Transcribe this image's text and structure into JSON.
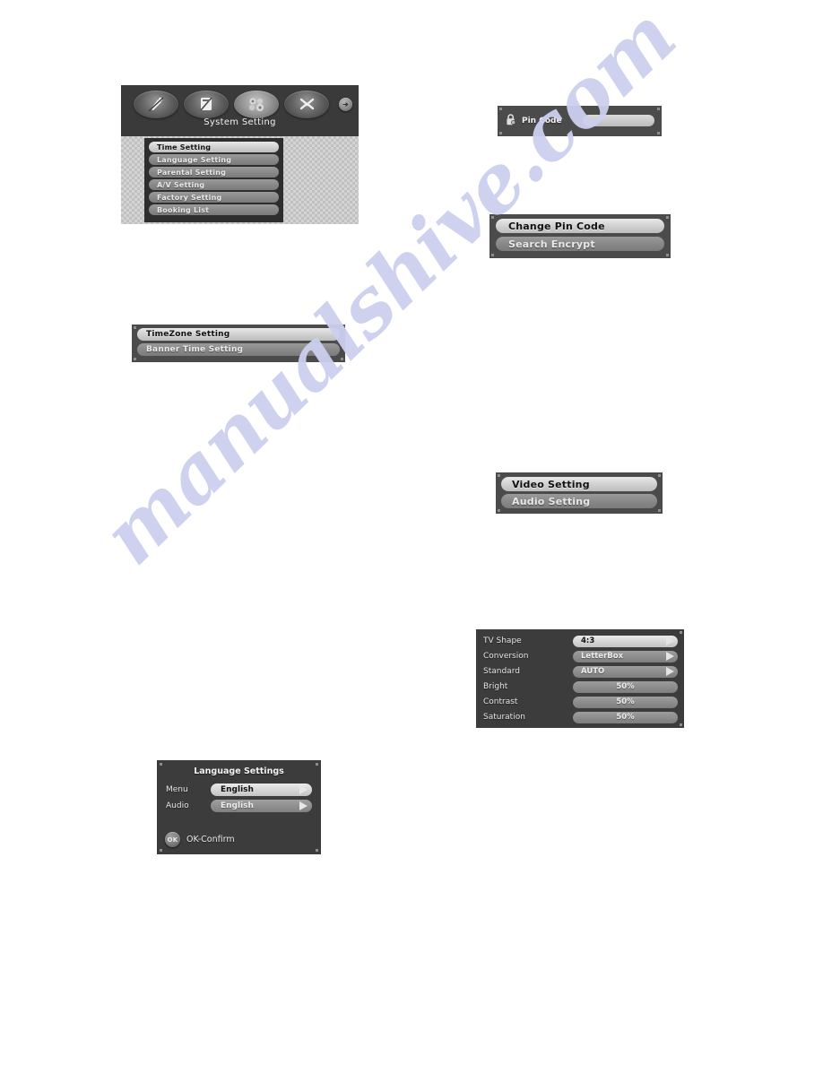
{
  "watermark": {
    "text": "manualshive.com"
  },
  "system_menu": {
    "title": "System Setting",
    "toolbar_icons": [
      {
        "name": "satellite-dish-icon",
        "active": false
      },
      {
        "name": "edit-channel-icon",
        "active": false
      },
      {
        "name": "system-setting-icon",
        "active": true
      },
      {
        "name": "tools-icon",
        "active": false
      }
    ],
    "next_arrow": "arrow-right-icon",
    "items": [
      {
        "label": "Time Setting",
        "selected": true
      },
      {
        "label": "Language Setting",
        "selected": false
      },
      {
        "label": "Parental Setting",
        "selected": false
      },
      {
        "label": "A/V Setting",
        "selected": false
      },
      {
        "label": "Factory Setting",
        "selected": false
      },
      {
        "label": "Booking List",
        "selected": false
      }
    ]
  },
  "time_menu": {
    "items": [
      {
        "label": "TimeZone Setting",
        "selected": true
      },
      {
        "label": "Banner Time Setting",
        "selected": false
      }
    ]
  },
  "pin_code": {
    "icon": "padlock-key-icon",
    "label": "Pin Code",
    "value": "",
    "placeholder": ""
  },
  "pin_menu": {
    "items": [
      {
        "label": "Change Pin Code",
        "selected": true
      },
      {
        "label": "Search Encrypt",
        "selected": false
      }
    ]
  },
  "av_menu": {
    "items": [
      {
        "label": "Video Setting",
        "selected": true
      },
      {
        "label": "Audio Setting",
        "selected": false
      }
    ]
  },
  "video_settings": {
    "rows": [
      {
        "label": "TV Shape",
        "value": "4:3",
        "selected": true,
        "arrow": true,
        "align": "left"
      },
      {
        "label": "Conversion",
        "value": "LetterBox",
        "selected": false,
        "arrow": true,
        "align": "left"
      },
      {
        "label": "Standard",
        "value": "AUTO",
        "selected": false,
        "arrow": true,
        "align": "left"
      },
      {
        "label": "Bright",
        "value": "50%",
        "selected": false,
        "arrow": false,
        "align": "center"
      },
      {
        "label": "Contrast",
        "value": "50%",
        "selected": false,
        "arrow": false,
        "align": "center"
      },
      {
        "label": "Saturation",
        "value": "50%",
        "selected": false,
        "arrow": false,
        "align": "center"
      }
    ]
  },
  "language_settings": {
    "title": "Language Settings",
    "rows": [
      {
        "label": "Menu",
        "value": "English",
        "selected": true
      },
      {
        "label": "Audio",
        "value": "English",
        "selected": false
      }
    ],
    "confirm_badge": "OK",
    "confirm_label": "OK-Confirm"
  }
}
